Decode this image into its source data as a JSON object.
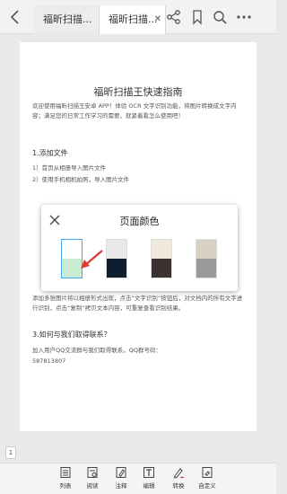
{
  "topbar": {
    "tabs": [
      {
        "label": "福昕扫描..."
      },
      {
        "label": "福昕扫描..."
      }
    ],
    "icons": [
      "back-icon",
      "share-icon",
      "bookmark-icon",
      "search-icon",
      "more-icon"
    ]
  },
  "document": {
    "title": "福昕扫描王快速指南",
    "intro": "欢迎使用福昕扫描王安卓 APP！体验 OCR 文字识别功能，将图片转换成文字内容；满足您的日常工作学习的需要，就紧着看怎么使用吧！",
    "section1_title": "1.添加文件",
    "section1_item1": "1）首页从相册导入图片文件",
    "section1_item2": "2）使用手机相机拍照，导入图片文件",
    "section2_text": "添加多张图片将以相册形式出现，点击“文字识别”按钮后，对文档内的所有文字进行识别，点击“复制”拷贝文本内容，可重复查看识别结果。",
    "section3_title": "3.如何与我们取得联系？",
    "section3_text": "加入用户QQ交流群与我们取得联系，QQ群号码：",
    "section3_number": "587813807"
  },
  "dialog": {
    "title": "页面颜色",
    "swatches": [
      {
        "name": "default",
        "top": "#ffffff",
        "bottom": "#c9ecd2"
      },
      {
        "name": "light-gray-dark-blue",
        "top": "#e8e8e8",
        "bottom": "#0f1e2f"
      },
      {
        "name": "beige-brown",
        "top": "#efe8dc",
        "bottom": "#3a3330"
      },
      {
        "name": "tan-gray",
        "top": "#d8d0c2",
        "bottom": "#9a9a9a"
      }
    ]
  },
  "page_indicator": "1",
  "bottombar": {
    "items": [
      {
        "label": "列表",
        "icon": "list-icon"
      },
      {
        "label": "阅读",
        "icon": "read-icon"
      },
      {
        "label": "注释",
        "icon": "annotate-icon"
      },
      {
        "label": "编辑",
        "icon": "edit-text-icon"
      },
      {
        "label": "转换",
        "icon": "convert-icon"
      },
      {
        "label": "自定义",
        "icon": "customize-icon"
      }
    ]
  },
  "colors": {
    "accent_red": "#e03a2f",
    "selected_blue": "#3fa9f5"
  }
}
